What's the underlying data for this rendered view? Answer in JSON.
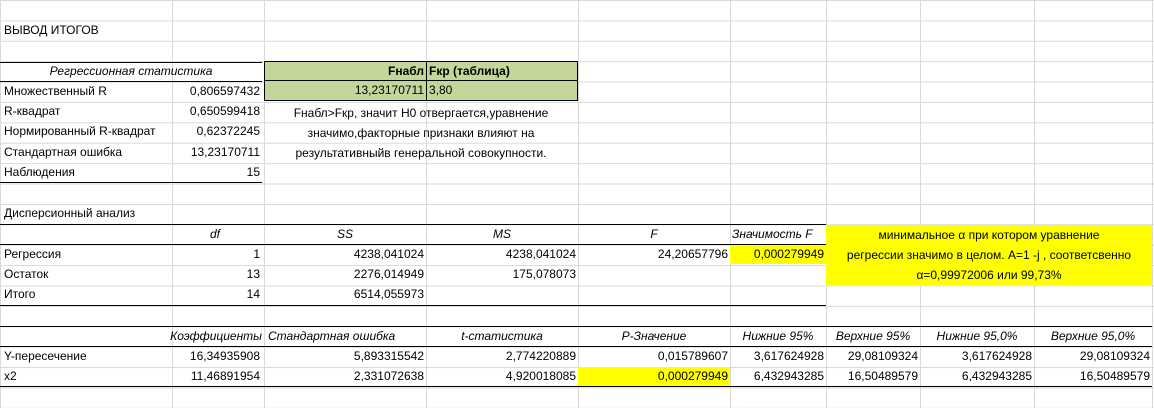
{
  "title": "ВЫВОД ИТОГОВ",
  "regression_stats": {
    "header": "Регрессионная статистика",
    "rows": [
      {
        "label": "Множественный R",
        "value": "0,806597432"
      },
      {
        "label": "R-квадрат",
        "value": "0,650599418"
      },
      {
        "label": "Нормированный R-квадрат",
        "value": "0,62372245"
      },
      {
        "label": "Стандартная ошибка",
        "value": "13,23170711"
      },
      {
        "label": "Наблюдения",
        "value": "15"
      }
    ]
  },
  "f_table": {
    "fnabl_header": "Fнабл",
    "fkr_header": "Fкр (таблица)",
    "fnabl_value": "13,23170711",
    "fkr_value": "3,80"
  },
  "f_note": [
    "Fнабл>Fкр, значит Н0 отвергается,уравнение",
    "значимо,факторные признаки влияют на",
    "результативныйв генеральной совокупности."
  ],
  "anova": {
    "title": "Дисперсионный анализ",
    "headers": [
      "df",
      "SS",
      "MS",
      "F",
      "Значимость F"
    ],
    "rows": [
      {
        "label": "Регрессия",
        "df": "1",
        "ss": "4238,041024",
        "ms": "4238,041024",
        "f": "24,20657796",
        "sig": "0,000279949"
      },
      {
        "label": "Остаток",
        "df": "13",
        "ss": "2276,014949",
        "ms": "175,078073",
        "f": "",
        "sig": ""
      },
      {
        "label": "Итого",
        "df": "14",
        "ss": "6514,055973",
        "ms": "",
        "f": "",
        "sig": ""
      }
    ]
  },
  "alpha_note": [
    "минимальное α при котором уравнение",
    "регрессии значимо в целом. А=1 -j , соответсвенно",
    "α=0,99972006 или 99,73%"
  ],
  "coefficients": {
    "headers": [
      "Коэффициенты",
      "Стандартная ошибка",
      "t-статистика",
      "P-Значение",
      "Нижние 95%",
      "Верхние 95%",
      "Нижние 95,0%",
      "Верхние 95,0%"
    ],
    "rows": [
      {
        "label": "Y-пересечение",
        "values": [
          "16,34935908",
          "5,893315542",
          "2,774220889",
          "0,015789607",
          "3,617624928",
          "29,08109324",
          "3,617624928",
          "29,08109324"
        ]
      },
      {
        "label": "x2",
        "values": [
          "11,46891954",
          "2,331072638",
          "4,920018085",
          "0,000279949",
          "6,432943285",
          "16,50489579",
          "6,432943285",
          "16,50489579"
        ]
      }
    ]
  },
  "colors": {
    "highlight_yellow": "#ffff00",
    "highlight_green": "#c4d79b",
    "gridline": "#d9d9d9"
  }
}
